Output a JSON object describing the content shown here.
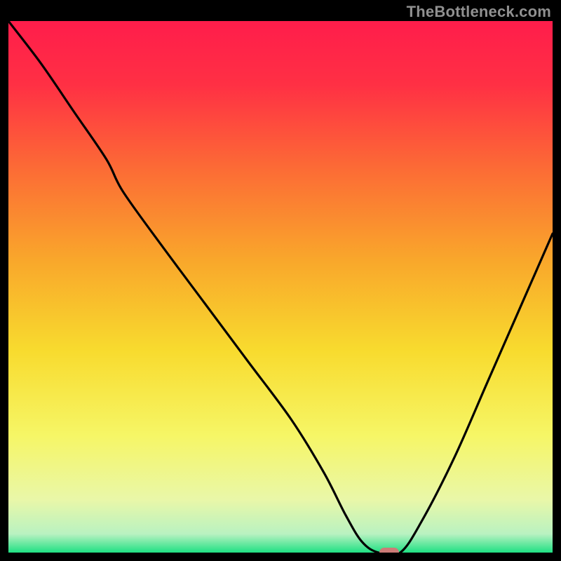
{
  "watermark": {
    "text": "TheBottleneck.com"
  },
  "chart_data": {
    "type": "line",
    "title": "",
    "xlabel": "",
    "ylabel": "",
    "xlim": [
      0,
      100
    ],
    "ylim": [
      0,
      100
    ],
    "gradient_stops": [
      {
        "offset": 0,
        "color": "#FF1D4B"
      },
      {
        "offset": 0.12,
        "color": "#FF3044"
      },
      {
        "offset": 0.28,
        "color": "#FC6C35"
      },
      {
        "offset": 0.45,
        "color": "#F9A72B"
      },
      {
        "offset": 0.62,
        "color": "#F8DB2E"
      },
      {
        "offset": 0.78,
        "color": "#F6F666"
      },
      {
        "offset": 0.9,
        "color": "#E9F7A8"
      },
      {
        "offset": 0.965,
        "color": "#B9F2C1"
      },
      {
        "offset": 1.0,
        "color": "#1FE083"
      }
    ],
    "series": [
      {
        "name": "bottleneck-curve",
        "type": "line",
        "x": [
          0,
          6,
          12,
          18,
          21,
          28,
          36,
          44,
          52,
          58,
          62,
          65,
          68,
          72,
          76,
          82,
          88,
          94,
          100
        ],
        "y": [
          100,
          92,
          83,
          74,
          68,
          58,
          47,
          36,
          25,
          15,
          7,
          2,
          0,
          0,
          6,
          18,
          32,
          46,
          60
        ]
      }
    ],
    "marker": {
      "x": 70,
      "y": 0,
      "color": "#CD7B77"
    }
  }
}
